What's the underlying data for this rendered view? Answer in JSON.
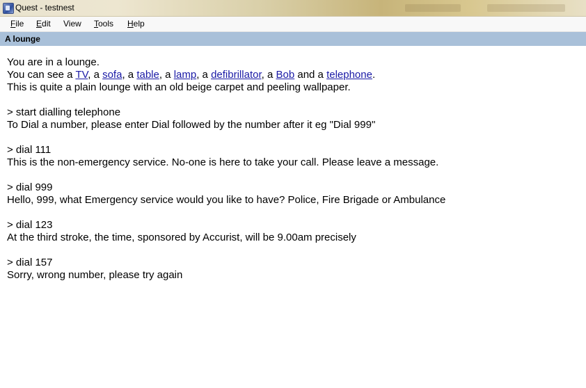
{
  "window": {
    "title": "Quest - testnest"
  },
  "menu": {
    "file": {
      "accel": "F",
      "rest": "ile"
    },
    "edit": {
      "accel": "E",
      "rest": "dit"
    },
    "view": {
      "label": "View"
    },
    "tools": {
      "accel": "T",
      "rest": "ools"
    },
    "help": {
      "accel": "H",
      "rest": "elp"
    }
  },
  "location": {
    "name": "A lounge"
  },
  "output": {
    "intro": {
      "line1": "You are in a lounge.",
      "see_prefix": "You can see a ",
      "sep_a": ", a ",
      "sep_and": " and a ",
      "period": ".",
      "objects": [
        "TV",
        "sofa",
        "table",
        "lamp",
        "defibrillator",
        "Bob",
        "telephone"
      ],
      "description": "This is quite a plain lounge with an old beige carpet and peeling wallpaper."
    },
    "exchanges": [
      {
        "command": "> start dialling telephone",
        "response": "To Dial a number, please enter Dial followed by the number after it eg \"Dial 999\""
      },
      {
        "command": "> dial 111",
        "response": "This is the non-emergency service. No-one is here to take your call. Please leave a message."
      },
      {
        "command": "> dial 999",
        "response": "Hello, 999, what Emergency service would you like to have? Police, Fire Brigade or Ambulance"
      },
      {
        "command": "> dial 123",
        "response": "At the third stroke, the time, sponsored by Accurist, will be 9.00am precisely"
      },
      {
        "command": "> dial 157",
        "response": "Sorry, wrong number, please try again"
      }
    ]
  },
  "colors": {
    "link": "#1a1aa6",
    "location_bar": "#a9c0d9",
    "menubar": "#f8f8f8"
  }
}
